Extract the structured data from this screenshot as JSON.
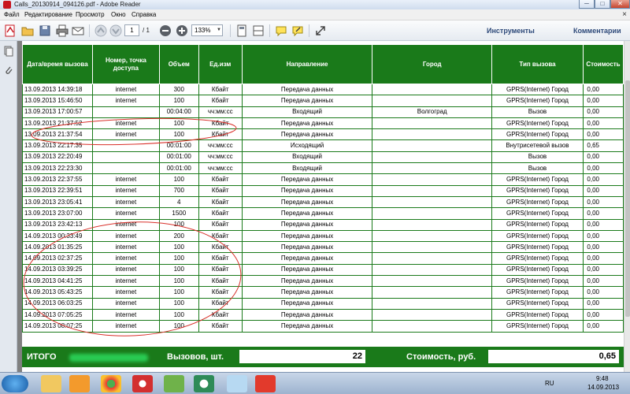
{
  "window": {
    "title": "Calls_20130914_094126.pdf - Adobe Reader",
    "min_label": "─",
    "max_label": "□",
    "close_label": "✕"
  },
  "menu": {
    "items": [
      "Файл",
      "Редактирование",
      "Просмотр",
      "Окно",
      "Справка"
    ],
    "close_doc": "×"
  },
  "toolbar": {
    "page_current": "1",
    "page_total": "/ 1",
    "zoom": "133%",
    "tools_link": "Инструменты",
    "comments_link": "Комментарии"
  },
  "table": {
    "headers": [
      "Дата/время вызова",
      "Номер, точка доступа",
      "Объем",
      "Ед.изм",
      "Направление",
      "Город",
      "Тип вызова",
      "Стоимость"
    ],
    "rows": [
      [
        "13.09.2013 14:39:18",
        "internet",
        "300",
        "Кбайт",
        "Передача данных",
        "",
        "GPRS(Internet) Город",
        "0,00"
      ],
      [
        "13.09.2013 15:46:50",
        "internet",
        "100",
        "Кбайт",
        "Передача данных",
        "",
        "GPRS(Internet) Город",
        "0,00"
      ],
      [
        "13.09.2013 17:00:57",
        "",
        "00:04:00",
        "чч:мм:сс",
        "Входящий",
        "Волгоград",
        "Вызов",
        "0,00"
      ],
      [
        "13.09.2013 21:37:52",
        "internet",
        "100",
        "Кбайт",
        "Передача данных",
        "",
        "GPRS(Internet) Город",
        "0,00"
      ],
      [
        "13.09.2013 21:37:54",
        "internet",
        "100",
        "Кбайт",
        "Передача данных",
        "",
        "GPRS(Internet) Город",
        "0,00"
      ],
      [
        "13.09.2013 22:17:35",
        "",
        "00:01:00",
        "чч:мм:сс",
        "Исходящий",
        "",
        "Внутрисетевой вызов",
        "0,65"
      ],
      [
        "13.09.2013 22:20:49",
        "",
        "00:01:00",
        "чч:мм:сс",
        "Входящий",
        "",
        "Вызов",
        "0,00"
      ],
      [
        "13.09.2013 22:23:30",
        "",
        "00:01:00",
        "чч:мм:сс",
        "Входящий",
        "",
        "Вызов",
        "0,00"
      ],
      [
        "13.09.2013 22:37:55",
        "internet",
        "100",
        "Кбайт",
        "Передача данных",
        "",
        "GPRS(Internet) Город",
        "0,00"
      ],
      [
        "13.09.2013 22:39:51",
        "internet",
        "700",
        "Кбайт",
        "Передача данных",
        "",
        "GPRS(Internet) Город",
        "0,00"
      ],
      [
        "13.09.2013 23:05:41",
        "internet",
        "4",
        "Кбайт",
        "Передача данных",
        "",
        "GPRS(Internet) Город",
        "0,00"
      ],
      [
        "13.09.2013 23:07:00",
        "internet",
        "1500",
        "Кбайт",
        "Передача данных",
        "",
        "GPRS(Internet) Город",
        "0,00"
      ],
      [
        "13.09.2013 23:42:13",
        "internet",
        "100",
        "Кбайт",
        "Передача данных",
        "",
        "GPRS(Internet) Город",
        "0,00"
      ],
      [
        "14.09.2013 00:33:49",
        "internet",
        "200",
        "Кбайт",
        "Передача данных",
        "",
        "GPRS(Internet) Город",
        "0,00"
      ],
      [
        "14.09.2013 01:35:25",
        "internet",
        "100",
        "Кбайт",
        "Передача данных",
        "",
        "GPRS(Internet) Город",
        "0,00"
      ],
      [
        "14.09.2013 02:37:25",
        "internet",
        "100",
        "Кбайт",
        "Передача данных",
        "",
        "GPRS(Internet) Город",
        "0,00"
      ],
      [
        "14.09.2013 03:39:25",
        "internet",
        "100",
        "Кбайт",
        "Передача данных",
        "",
        "GPRS(Internet) Город",
        "0,00"
      ],
      [
        "14.09.2013 04:41:25",
        "internet",
        "100",
        "Кбайт",
        "Передача данных",
        "",
        "GPRS(Internet) Город",
        "0,00"
      ],
      [
        "14.09.2013 05:43:25",
        "internet",
        "100",
        "Кбайт",
        "Передача данных",
        "",
        "GPRS(Internet) Город",
        "0,00"
      ],
      [
        "14.09.2013 06:03:25",
        "internet",
        "100",
        "Кбайт",
        "Передача данных",
        "",
        "GPRS(Internet) Город",
        "0,00"
      ],
      [
        "14.09.2013 07:05:25",
        "internet",
        "100",
        "Кбайт",
        "Передача данных",
        "",
        "GPRS(Internet) Город",
        "0,00"
      ],
      [
        "14.09.2013 08:07:25",
        "internet",
        "100",
        "Кбайт",
        "Передача данных",
        "",
        "GPRS(Internet) Город",
        "0,00"
      ]
    ]
  },
  "totals": {
    "label": "ИТОГО",
    "calls_label": "Вызовов, шт.",
    "calls_value": "22",
    "cost_label": "Стоимость, руб.",
    "cost_value": "0,65"
  },
  "taskbar": {
    "lang": "RU",
    "time": "9:48",
    "date": "14.09.2013"
  },
  "colors": {
    "table_green": "#1a7a1a",
    "annotation_red": "#d9302a"
  }
}
